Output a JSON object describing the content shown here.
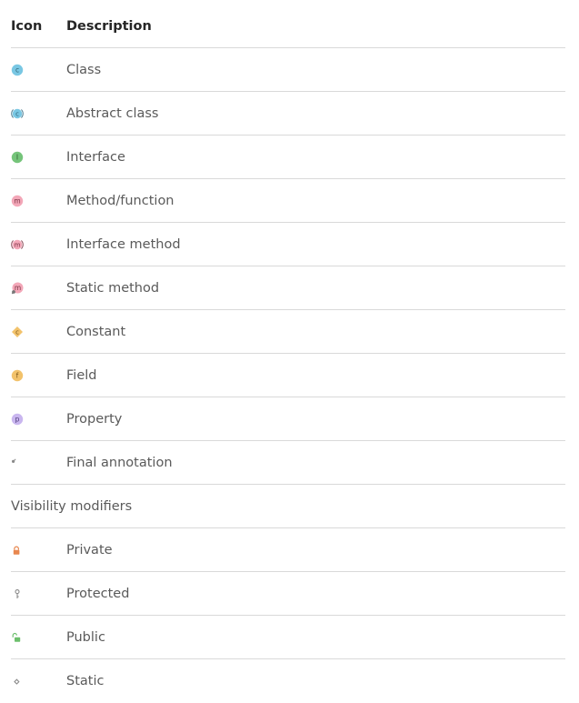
{
  "header": {
    "icon_label": "Icon",
    "description_label": "Description"
  },
  "symbols": [
    {
      "icon": "class-icon",
      "description": "Class"
    },
    {
      "icon": "abstract-class-icon",
      "description": "Abstract class"
    },
    {
      "icon": "interface-icon",
      "description": "Interface"
    },
    {
      "icon": "method-icon",
      "description": "Method/function"
    },
    {
      "icon": "interface-method-icon",
      "description": "Interface method"
    },
    {
      "icon": "static-method-icon",
      "description": "Static method"
    },
    {
      "icon": "constant-icon",
      "description": "Constant"
    },
    {
      "icon": "field-icon",
      "description": "Field"
    },
    {
      "icon": "property-icon",
      "description": "Property"
    },
    {
      "icon": "final-annotation-icon",
      "description": "Final annotation"
    }
  ],
  "visibility_section": {
    "title": "Visibility modifiers"
  },
  "visibility": [
    {
      "icon": "private-lock-icon",
      "description": "Private"
    },
    {
      "icon": "protected-key-icon",
      "description": "Protected"
    },
    {
      "icon": "public-unlock-icon",
      "description": "Public"
    },
    {
      "icon": "static-diamond-icon",
      "description": "Static"
    }
  ],
  "colors": {
    "class_blue": "#79c7e3",
    "interface_green": "#75c47a",
    "method_pink": "#f3a7b8",
    "constant_orange": "#f2c26b",
    "property_purple": "#c9b6ef",
    "private_orange": "#e8874f",
    "public_green": "#6cbf6c",
    "divider": "#d9d9d9",
    "header_text": "#262626",
    "body_text": "#5a5a5a"
  }
}
